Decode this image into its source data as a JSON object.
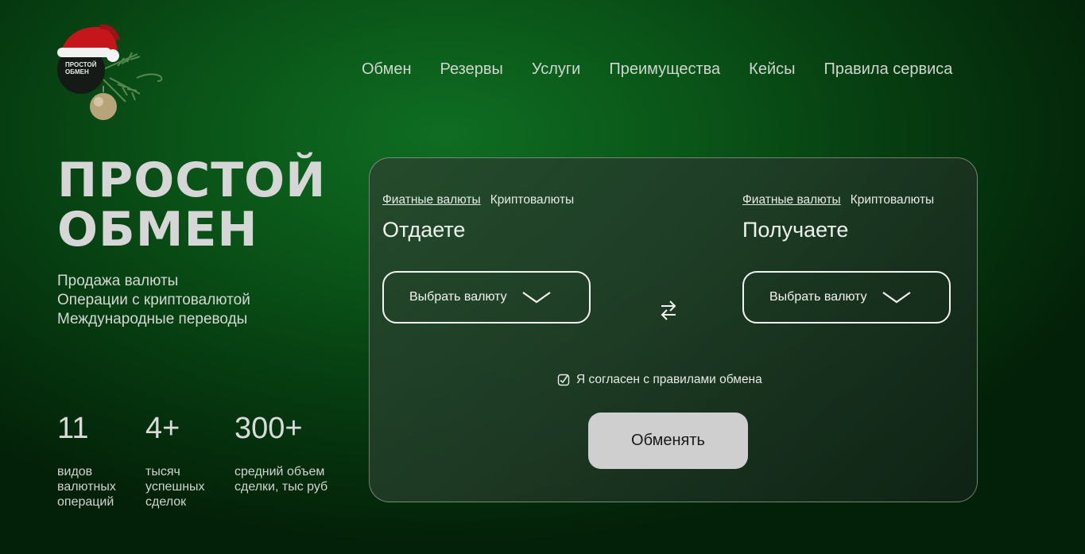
{
  "logo": {
    "line1": "ПРОСТОЙ",
    "line2": "ОБМЕН"
  },
  "nav": [
    "Обмен",
    "Резервы",
    "Услуги",
    "Преимущества",
    "Кейсы",
    "Правила сервиса"
  ],
  "hero": {
    "title_line1": "ПРОСТОЙ",
    "title_line2": "ОБМЕН",
    "services": [
      "Продажа валюты",
      "Операции с криптовалютой",
      "Международные переводы"
    ]
  },
  "stats": [
    {
      "value": "11",
      "desc": [
        "видов",
        "валютных",
        "операций"
      ]
    },
    {
      "value": "4+",
      "desc": [
        "тысяч",
        "успешных",
        "сделок"
      ]
    },
    {
      "value": "300+",
      "desc": [
        "средний объем",
        "сделки, тыс руб"
      ]
    }
  ],
  "exchange": {
    "give": {
      "tab_fiat": "Фиатные валюты",
      "tab_crypto": "Криптовалюты",
      "title": "Отдаете",
      "select": "Выбрать валюту"
    },
    "get": {
      "tab_fiat": "Фиатные валюты",
      "tab_crypto": "Криптовалюты",
      "title": "Получаете",
      "select": "Выбрать валюту"
    },
    "agree_label": "Я согласен с правилами обмена",
    "submit_label": "Обменять"
  }
}
